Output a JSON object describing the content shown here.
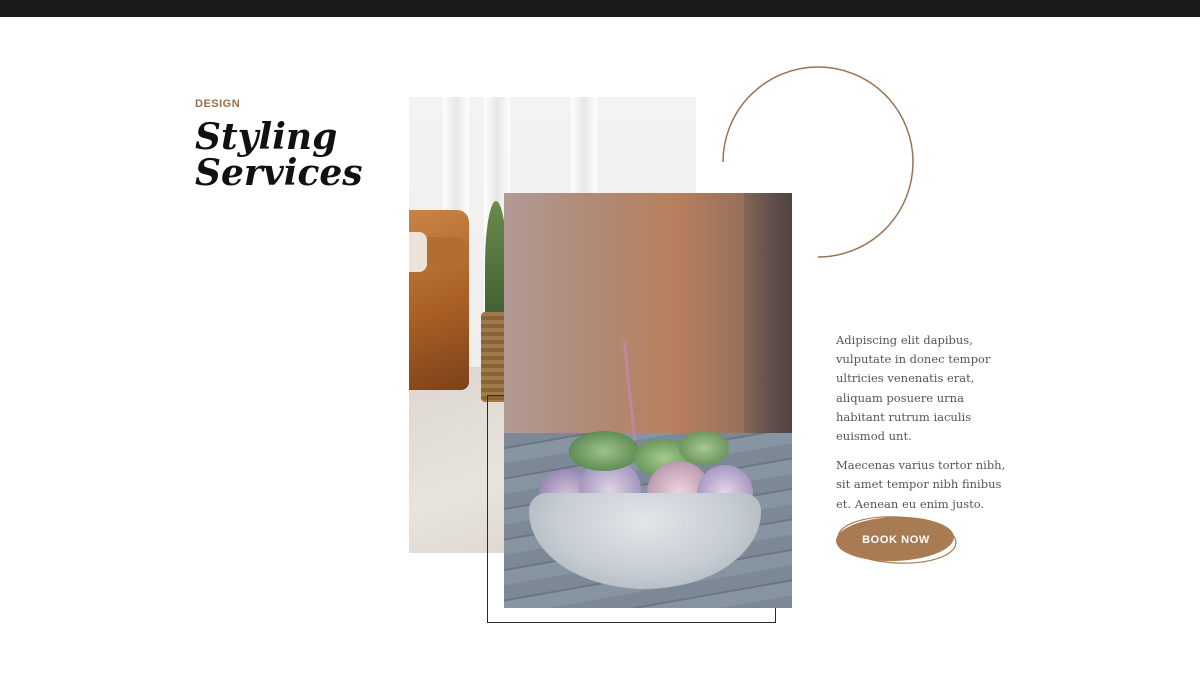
{
  "section": {
    "eyebrow": "DESIGN",
    "title_line1": "Styling",
    "title_line2": "Services"
  },
  "copy": {
    "paragraph1": "Adipiscing elit dapibus, vulputate in donec tempor ultricies venenatis erat, aliquam posuere urna habitant rutrum iaculis euismod unt.",
    "paragraph2": "Maecenas varius tortor nibh, sit amet tempor nibh finibus et. Aenean eu enim justo."
  },
  "cta": {
    "label": "BOOK NOW"
  },
  "colors": {
    "accent": "#a87b52",
    "eyebrow": "#9a6f45",
    "top_bar": "#1a1a1a",
    "title": "#111111",
    "body_text": "#555555"
  },
  "images": {
    "back_photo": "living-room-leather-chair-plant",
    "front_photo": "succulent-bowl-on-table"
  }
}
